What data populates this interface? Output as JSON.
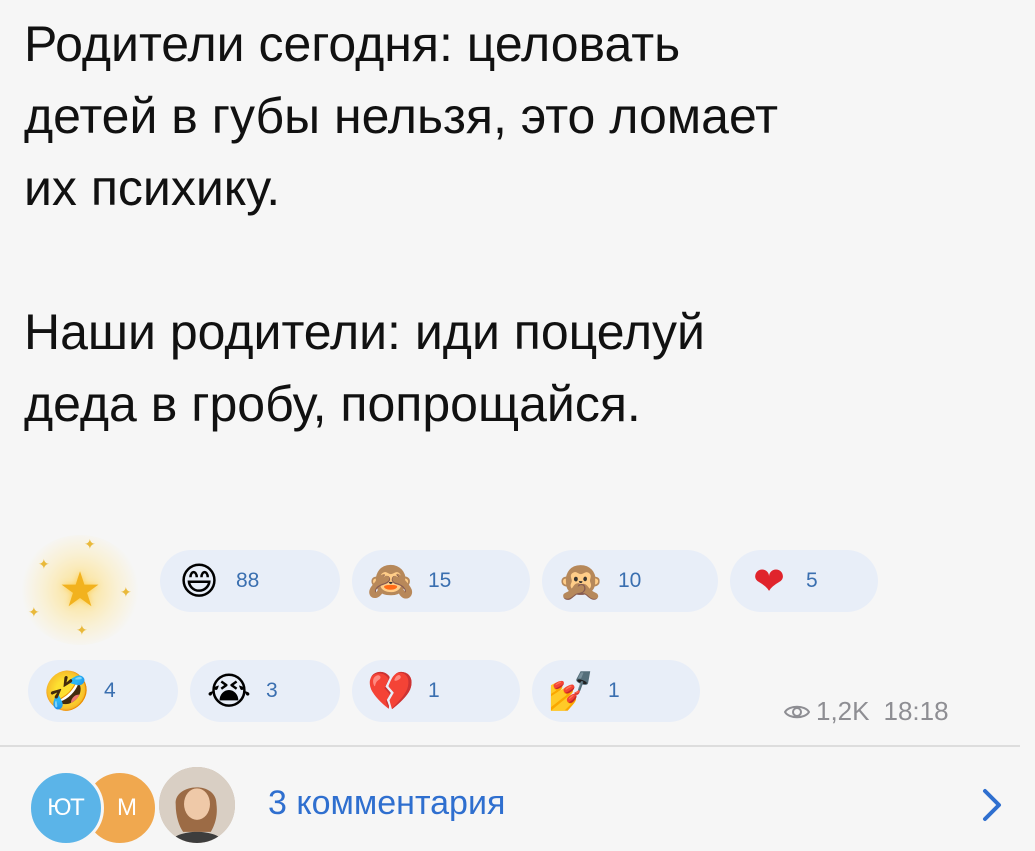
{
  "post": {
    "paragraph1": "Родители сегодня: целовать\nдетей в губы нельзя, это ломает\nих психику.",
    "paragraph2": "Наши родители: иди поцелуй\nдеда в гробу, попрощайся."
  },
  "reactions": [
    {
      "emoji": "😄",
      "count": "88"
    },
    {
      "emoji": "🙈",
      "count": "15"
    },
    {
      "emoji": "🙊",
      "count": "10"
    },
    {
      "emoji": "❤",
      "count": "5"
    },
    {
      "emoji": "🤣",
      "count": "4"
    },
    {
      "emoji": "😭",
      "count": "3"
    },
    {
      "emoji": "💔",
      "count": "1"
    },
    {
      "emoji": "💅",
      "count": "1"
    }
  ],
  "paid_reaction": {
    "icon": "star-icon",
    "glyph": "★"
  },
  "meta": {
    "views": "1,2K",
    "time": "18:18"
  },
  "comments": {
    "label": "3 комментария",
    "avatars": [
      {
        "initials": "ЮТ",
        "color": "#5bb4e8"
      },
      {
        "initials": "М",
        "color": "#f0a84f"
      },
      {
        "initials": "",
        "color": "#c9b8a8"
      }
    ]
  },
  "colors": {
    "accent": "#2f6fcf",
    "reaction_bg": "#e8eef8",
    "reaction_count": "#3a6fb0",
    "meta_text": "#8e8e93"
  }
}
